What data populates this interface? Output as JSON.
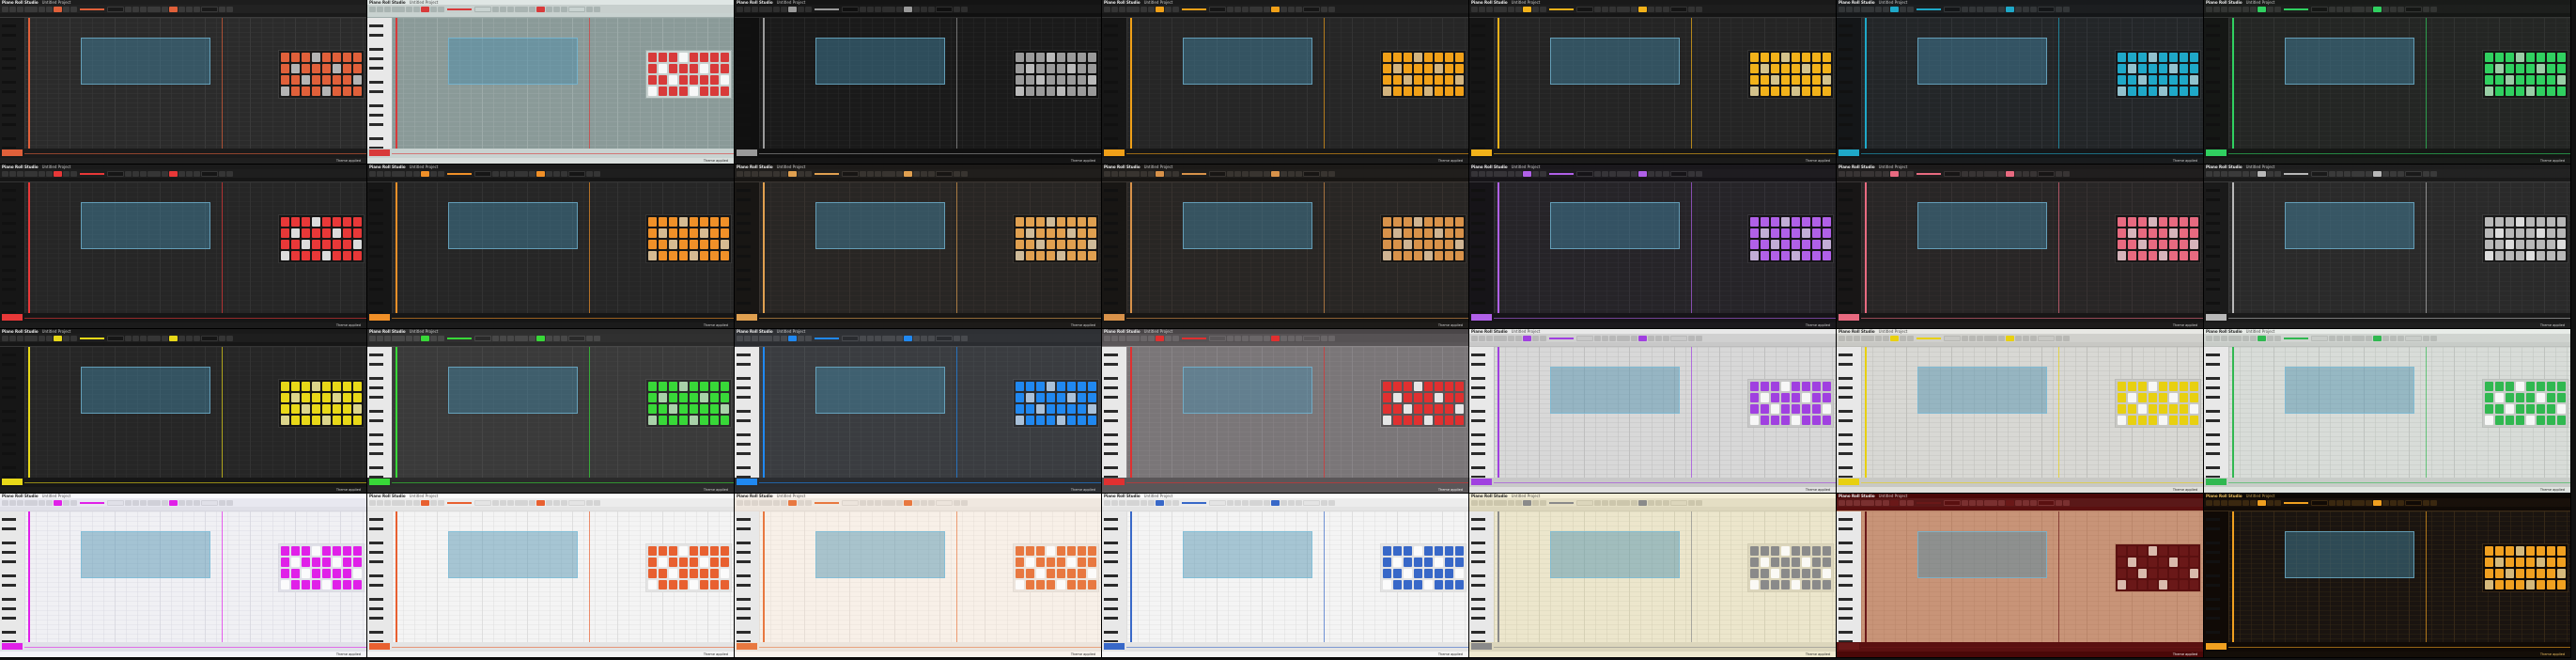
{
  "app": {
    "title": "Piano Roll Studio",
    "project_name": "Untitled Project",
    "status_template": "Theme applied"
  },
  "themes": [
    {
      "bg": "#2b2b2b",
      "panel": "#1a1a1a",
      "title_bg": "#1d1d1d",
      "title_fg": "#f0f0f0",
      "toolbar": "#222222",
      "btn": "#3a3a3a",
      "accent": "#e0603a",
      "grid": "#3c3c3c",
      "text": "#d0d0d0",
      "piano_light": false,
      "status_bg": "#1f1f1f",
      "off_btn": "#d0d0d0"
    },
    {
      "bg": "#8a9a98",
      "panel": "#c8d2d0",
      "title_bg": "#dfe6e4",
      "title_fg": "#222222",
      "toolbar": "#c7cfcd",
      "btn": "#a9b4b2",
      "accent": "#d83a3a",
      "grid": "#9fadab",
      "text": "#222222",
      "piano_light": true,
      "status_bg": "#d8dedc",
      "off_btn": "#ffffff"
    },
    {
      "bg": "#1a1a1a",
      "panel": "#101010",
      "title_bg": "#141414",
      "title_fg": "#e8e8e8",
      "toolbar": "#181818",
      "btn": "#2e2e2e",
      "accent": "#9a9a9a",
      "grid": "#2a2a2a",
      "text": "#cfcfcf",
      "piano_light": false,
      "status_bg": "#151515",
      "off_btn": "#d8d8d8"
    },
    {
      "bg": "#262626",
      "panel": "#161616",
      "title_bg": "#1a1a1a",
      "title_fg": "#eeeeee",
      "toolbar": "#1e1e1e",
      "btn": "#353535",
      "accent": "#f0a018",
      "grid": "#353535",
      "text": "#d0d0d0",
      "piano_light": false,
      "status_bg": "#1b1b1b",
      "off_btn": "#f5d090"
    },
    {
      "bg": "#242424",
      "panel": "#151515",
      "title_bg": "#191919",
      "title_fg": "#eeeeee",
      "toolbar": "#1d1d1d",
      "btn": "#333333",
      "accent": "#f2b21a",
      "grid": "#343434",
      "text": "#d0d0d0",
      "piano_light": false,
      "status_bg": "#1a1a1a",
      "off_btn": "#f5e0a0"
    },
    {
      "bg": "#232628",
      "panel": "#141618",
      "title_bg": "#181a1c",
      "title_fg": "#eeeeee",
      "toolbar": "#1c1e20",
      "btn": "#333638",
      "accent": "#1fa8c8",
      "grid": "#333638",
      "text": "#d0d0d0",
      "piano_light": false,
      "status_bg": "#191b1d",
      "off_btn": "#a8e0ee"
    },
    {
      "bg": "#242624",
      "panel": "#151715",
      "title_bg": "#191b19",
      "title_fg": "#eeeeee",
      "toolbar": "#1d1f1d",
      "btn": "#333533",
      "accent": "#30d060",
      "grid": "#343634",
      "text": "#d0d0d0",
      "piano_light": false,
      "status_bg": "#1a1c1a",
      "off_btn": "#b0f0c0"
    },
    {
      "bg": "#262626",
      "panel": "#161616",
      "title_bg": "#1a1a1a",
      "title_fg": "#eeeeee",
      "toolbar": "#1e1e1e",
      "btn": "#353535",
      "accent": "#e83838",
      "grid": "#353535",
      "text": "#d0d0d0",
      "piano_light": false,
      "status_bg": "#1b1b1b",
      "off_btn": "#ffffff"
    },
    {
      "bg": "#262626",
      "panel": "#161616",
      "title_bg": "#1a1a1a",
      "title_fg": "#eeeeee",
      "toolbar": "#1e1e1e",
      "btn": "#353535",
      "accent": "#f09028",
      "grid": "#353535",
      "text": "#d0d0d0",
      "piano_light": false,
      "status_bg": "#1b1b1b",
      "off_btn": "#f8d8a8"
    },
    {
      "bg": "#282624",
      "panel": "#181614",
      "title_bg": "#1c1a18",
      "title_fg": "#eeeeee",
      "toolbar": "#201e1c",
      "btn": "#383430",
      "accent": "#e0a050",
      "grid": "#383430",
      "text": "#d0d0d0",
      "piano_light": false,
      "status_bg": "#1d1b19",
      "off_btn": "#f0d8b0"
    },
    {
      "bg": "#282624",
      "panel": "#181614",
      "title_bg": "#1c1a18",
      "title_fg": "#eeeeee",
      "toolbar": "#201e1c",
      "btn": "#383430",
      "accent": "#d8924a",
      "grid": "#383430",
      "text": "#d0d0d0",
      "piano_light": false,
      "status_bg": "#1d1b19",
      "off_btn": "#f0d0a8"
    },
    {
      "bg": "#262428",
      "panel": "#161418",
      "title_bg": "#1a181c",
      "title_fg": "#eeeeee",
      "toolbar": "#1e1c20",
      "btn": "#363438",
      "accent": "#b060e8",
      "grid": "#363438",
      "text": "#d0d0d0",
      "piano_light": false,
      "status_bg": "#1b191d",
      "off_btn": "#e0c8f8"
    },
    {
      "bg": "#282626",
      "panel": "#181616",
      "title_bg": "#1c1a1a",
      "title_fg": "#eeeeee",
      "toolbar": "#201e1e",
      "btn": "#383434",
      "accent": "#e86a80",
      "grid": "#383434",
      "text": "#d0d0d0",
      "piano_light": false,
      "status_bg": "#1d1b1b",
      "off_btn": "#f8d0d8"
    },
    {
      "bg": "#2a2a2a",
      "panel": "#1a1a1a",
      "title_bg": "#1e1e1e",
      "title_fg": "#eeeeee",
      "toolbar": "#222222",
      "btn": "#3a3a3a",
      "accent": "#b8b8b8",
      "grid": "#3a3a3a",
      "text": "#d0d0d0",
      "piano_light": false,
      "status_bg": "#1f1f1f",
      "off_btn": "#ffffff"
    },
    {
      "bg": "#262626",
      "panel": "#161616",
      "title_bg": "#1a1a1a",
      "title_fg": "#eeeeee",
      "toolbar": "#1e1e1e",
      "btn": "#353535",
      "accent": "#e8d818",
      "grid": "#353535",
      "text": "#d0d0d0",
      "piano_light": false,
      "status_bg": "#1b1b1b",
      "off_btn": "#fff7a0"
    },
    {
      "bg": "#3a3a3a",
      "panel": "#2a2a2a",
      "title_bg": "#2e2e2e",
      "title_fg": "#eeeeee",
      "toolbar": "#303030",
      "btn": "#484848",
      "accent": "#38d838",
      "grid": "#484848",
      "text": "#d0d0d0",
      "piano_light": true,
      "status_bg": "#2c2c2c",
      "off_btn": "#c0f0c0"
    },
    {
      "bg": "#3a3c40",
      "panel": "#2a2c30",
      "title_bg": "#2e3034",
      "title_fg": "#eeeeee",
      "toolbar": "#303236",
      "btn": "#484a4e",
      "accent": "#2088f0",
      "grid": "#484a4e",
      "text": "#d0d0d0",
      "piano_light": true,
      "status_bg": "#2c2e32",
      "off_btn": "#c0dcf8"
    },
    {
      "bg": "#7a7678",
      "panel": "#5a5658",
      "title_bg": "#4a4648",
      "title_fg": "#eeeeee",
      "toolbar": "#565254",
      "btn": "#6a6668",
      "accent": "#e03030",
      "grid": "#8a8688",
      "text": "#f0f0f0",
      "piano_light": true,
      "status_bg": "#5a5658",
      "off_btn": "#ffffff"
    },
    {
      "bg": "#d8d8d8",
      "panel": "#c8c8c8",
      "title_bg": "#e8e8e8",
      "title_fg": "#222222",
      "toolbar": "#d0d0d0",
      "btn": "#b8b8b8",
      "accent": "#a040e0",
      "grid": "#bcbcbc",
      "text": "#222222",
      "piano_light": true,
      "status_bg": "#e0e0e0",
      "off_btn": "#ffffff"
    },
    {
      "bg": "#d8d8d4",
      "panel": "#c8c8c4",
      "title_bg": "#e8e8e4",
      "title_fg": "#222222",
      "toolbar": "#d0d0cc",
      "btn": "#b8b8b4",
      "accent": "#e8d010",
      "grid": "#bcbcb8",
      "text": "#222222",
      "piano_light": true,
      "status_bg": "#e0e0dc",
      "off_btn": "#ffffff"
    },
    {
      "bg": "#d8dcd8",
      "panel": "#c8ccc8",
      "title_bg": "#e8ece8",
      "title_fg": "#222222",
      "toolbar": "#d0d4d0",
      "btn": "#b8bcb8",
      "accent": "#30b850",
      "grid": "#bcc0bc",
      "text": "#222222",
      "piano_light": true,
      "status_bg": "#e0e4e0",
      "off_btn": "#ffffff"
    },
    {
      "bg": "#f0f0f4",
      "panel": "#e0e0e8",
      "title_bg": "#f8f8fc",
      "title_fg": "#222222",
      "toolbar": "#e8e8f0",
      "btn": "#d0d0d8",
      "accent": "#e020e8",
      "grid": "#d8d8e0",
      "text": "#222222",
      "piano_light": true,
      "status_bg": "#f4f4f8",
      "off_btn": "#ffffff"
    },
    {
      "bg": "#f4f4f4",
      "panel": "#e4e4e4",
      "title_bg": "#fafafa",
      "title_fg": "#222222",
      "toolbar": "#ececec",
      "btn": "#d4d4d4",
      "accent": "#e86030",
      "grid": "#dcdcdc",
      "text": "#222222",
      "piano_light": true,
      "status_bg": "#f6f6f6",
      "off_btn": "#ffffff"
    },
    {
      "bg": "#f8f0e8",
      "panel": "#ece4dc",
      "title_bg": "#fcf6f0",
      "title_fg": "#222222",
      "toolbar": "#f0e8e0",
      "btn": "#dcd4cc",
      "accent": "#e87840",
      "grid": "#e4dcd4",
      "text": "#222222",
      "piano_light": true,
      "status_bg": "#faf4ee",
      "off_btn": "#ffffff"
    },
    {
      "bg": "#f4f4f4",
      "panel": "#e4e4e4",
      "title_bg": "#fafafa",
      "title_fg": "#222222",
      "toolbar": "#ececec",
      "btn": "#d4d4d4",
      "accent": "#3868c8",
      "grid": "#dcdcdc",
      "text": "#222222",
      "piano_light": true,
      "status_bg": "#f6f6f6",
      "off_btn": "#ffffff"
    },
    {
      "bg": "#ece6cc",
      "panel": "#dcd6bc",
      "title_bg": "#f4eed6",
      "title_fg": "#222222",
      "toolbar": "#e4dec4",
      "btn": "#ccc6ac",
      "accent": "#8a8a8a",
      "grid": "#d4ceb4",
      "text": "#222222",
      "piano_light": true,
      "status_bg": "#f0ead0",
      "off_btn": "#ffffff"
    },
    {
      "bg": "#c89478",
      "panel": "#5a1010",
      "title_bg": "#4a0808",
      "title_fg": "#eeeeee",
      "toolbar": "#5a1818",
      "btn": "#7a3030",
      "accent": "#6a1818",
      "grid": "#b88468",
      "text": "#f0f0f0",
      "piano_light": true,
      "status_bg": "#4a0808",
      "off_btn": "#f0d8c8"
    },
    {
      "bg": "#1a1410",
      "panel": "#100a06",
      "title_bg": "#0c0804",
      "title_fg": "#f0c060",
      "toolbar": "#18100a",
      "btn": "#3a2810",
      "accent": "#f0a020",
      "grid": "#3a2a18",
      "text": "#f0c060",
      "piano_light": false,
      "status_bg": "#140e08",
      "off_btn": "#f8d890"
    }
  ],
  "palette_pattern": [
    1,
    1,
    1,
    0,
    1,
    1,
    1,
    1,
    1,
    0,
    1,
    1,
    1,
    0,
    1,
    1,
    1,
    1,
    0,
    1,
    1,
    1,
    1,
    0,
    0,
    1,
    1,
    1,
    0,
    1,
    1,
    1
  ]
}
